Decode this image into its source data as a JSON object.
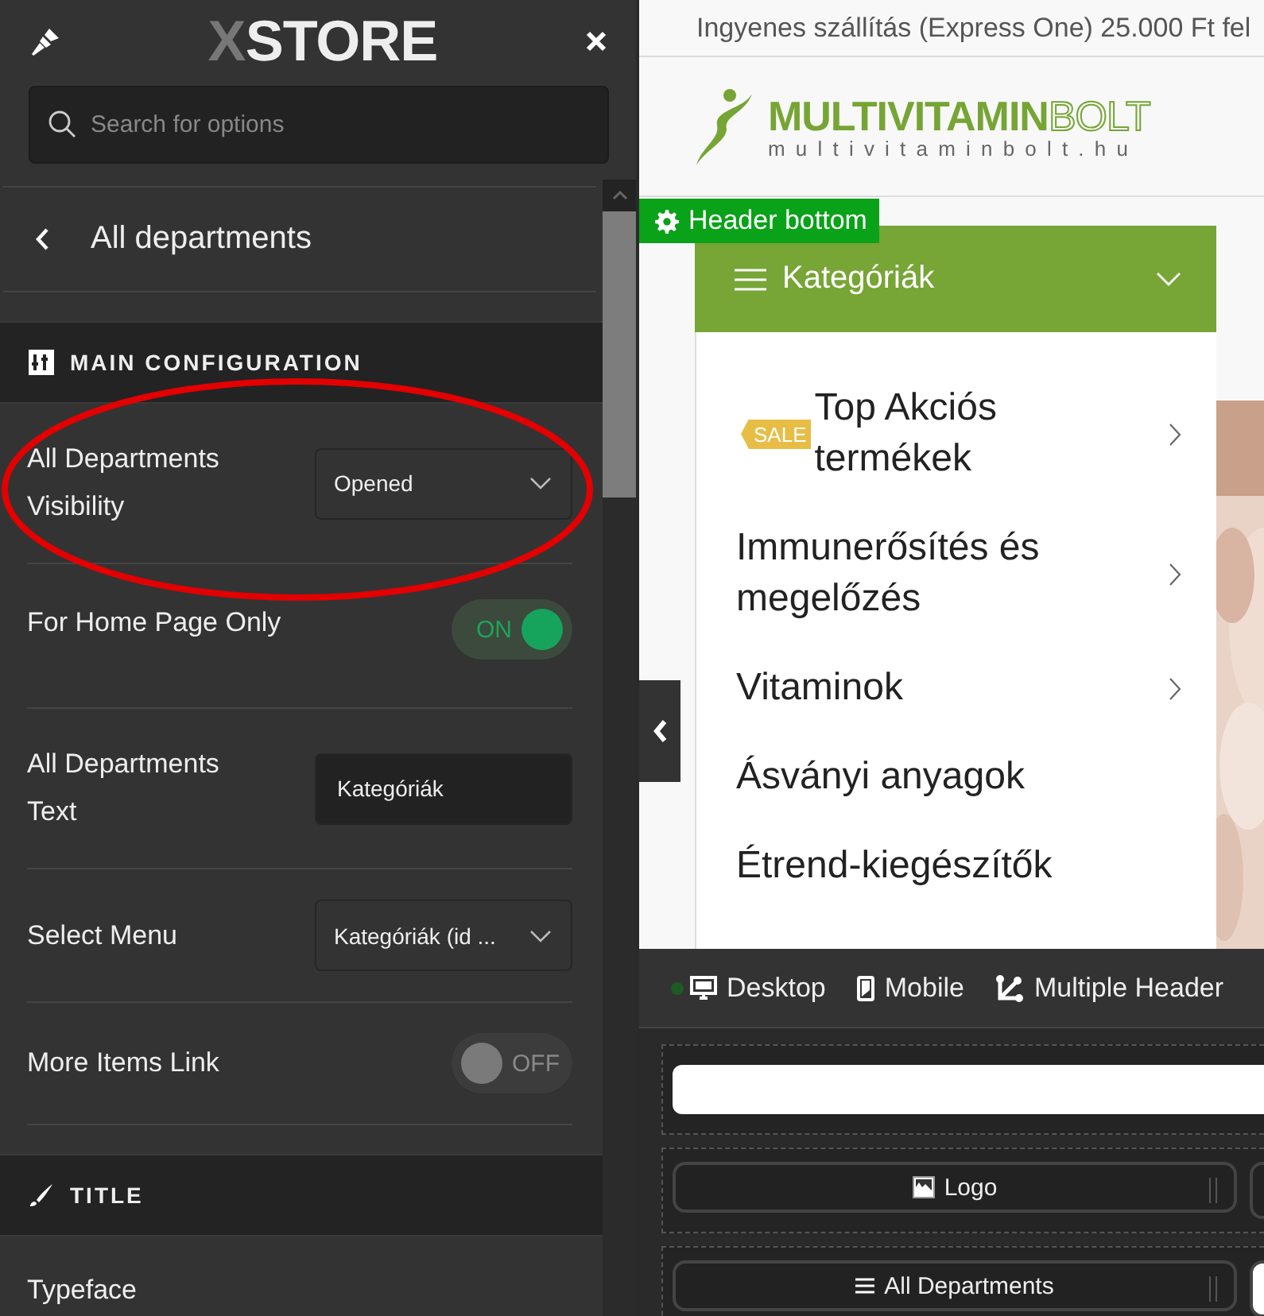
{
  "panel": {
    "logo": {
      "mark": "X",
      "text": "STORE"
    },
    "search": {
      "placeholder": "Search for options"
    },
    "back_title": "All departments",
    "sections": [
      {
        "kind": "config",
        "title": "MAIN CONFIGURATION",
        "settings": [
          {
            "kind": "select",
            "label": "All Departments Visibility",
            "value": "Opened"
          },
          {
            "kind": "toggle",
            "label": "For Home Page Only",
            "on": true,
            "state_text": "ON"
          },
          {
            "kind": "text",
            "label": "All Departments Text",
            "value": "Kategóriák"
          },
          {
            "kind": "select",
            "label": "Select Menu",
            "value": "Kategóriák (id ..."
          },
          {
            "kind": "toggle",
            "label": "More Items Link",
            "on": false,
            "state_text": "OFF"
          }
        ]
      },
      {
        "kind": "style",
        "title": "TITLE",
        "settings": [
          {
            "kind": "heading",
            "label": "Typeface"
          }
        ]
      }
    ]
  },
  "preview": {
    "notice": "Ingyenes szállítás (Express One) 25.000 Ft fel",
    "brand": {
      "name_bold": "MULTIVITAMIN",
      "name_outline": "BOLT",
      "domain": "multivitaminbolt.hu"
    },
    "area_label": "Header bottom",
    "departments": {
      "title": "Kategóriák",
      "expanded": true,
      "items": [
        {
          "label": "Top Akciós termékek",
          "badge": "SALE",
          "has_children": true
        },
        {
          "label": "Immunerősítés és megelőzés",
          "has_children": true
        },
        {
          "label": "Vitaminok",
          "has_children": true
        },
        {
          "label": "Ásványi anyagok",
          "has_children": false
        },
        {
          "label": "Étrend-kiegészítők",
          "has_children": false
        }
      ]
    }
  },
  "builder": {
    "tabs": [
      {
        "label": "Desktop",
        "selected": true
      },
      {
        "label": "Mobile",
        "selected": false
      },
      {
        "label": "Multiple Header",
        "selected": false
      }
    ],
    "rows": [
      {
        "kind": "blank"
      },
      {
        "kind": "element",
        "label": "Logo"
      },
      {
        "kind": "element",
        "label": "All Departments"
      }
    ]
  }
}
